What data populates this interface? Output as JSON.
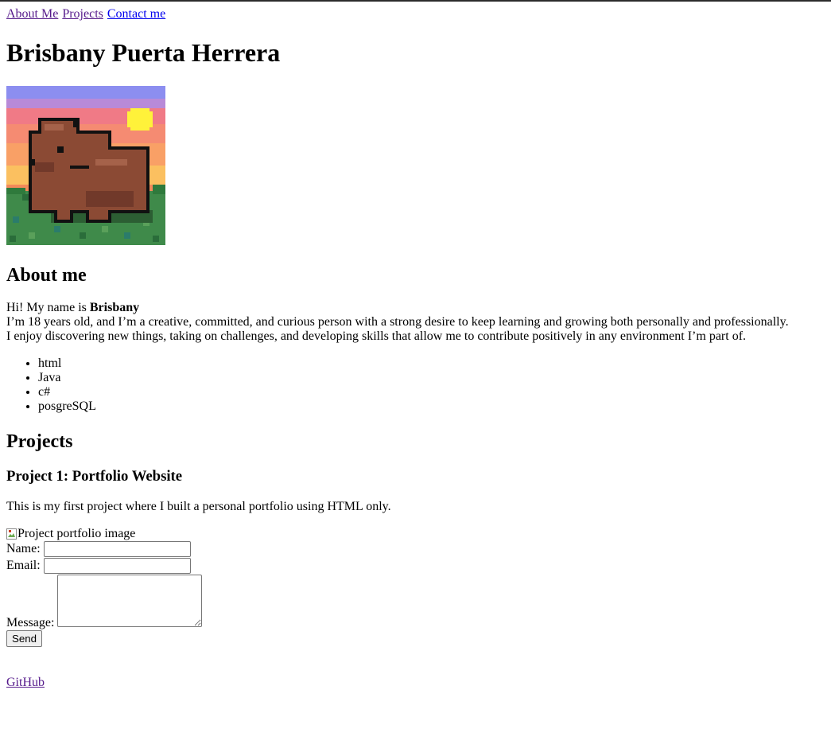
{
  "nav": {
    "about": "About Me",
    "projects": "Projects",
    "contact": "Contact me"
  },
  "header": {
    "title": "Brisbany Puerta Herrera"
  },
  "avatar": {
    "icon": "capybara-pixel-art"
  },
  "about": {
    "heading": "About me",
    "greeting": "Hi! My name is ",
    "name": "Brisbany",
    "line2": "I’m 18 years old, and I’m a creative, committed, and curious person with a strong desire to keep learning and growing both personally and professionally.",
    "line3": "I enjoy discovering new things, taking on challenges, and developing skills that allow me to contribute positively in any environment I’m part of.",
    "skills": [
      "html",
      "Java",
      "c#",
      "posgreSQL"
    ]
  },
  "projects": {
    "heading": "Projects",
    "project1": {
      "title": "Project 1: Portfolio Website",
      "description": "This is my first project where I built a personal portfolio using HTML only.",
      "image_alt": "Project portfolio image"
    }
  },
  "contact_form": {
    "name_label": "Name:",
    "name_value": "",
    "email_label": "Email:",
    "email_value": "",
    "message_label": "Message:",
    "message_value": "",
    "send_label": "Send"
  },
  "footer": {
    "github": "GitHub"
  },
  "colors": {
    "link": "#0000ee",
    "visited_link": "#551a8b"
  }
}
